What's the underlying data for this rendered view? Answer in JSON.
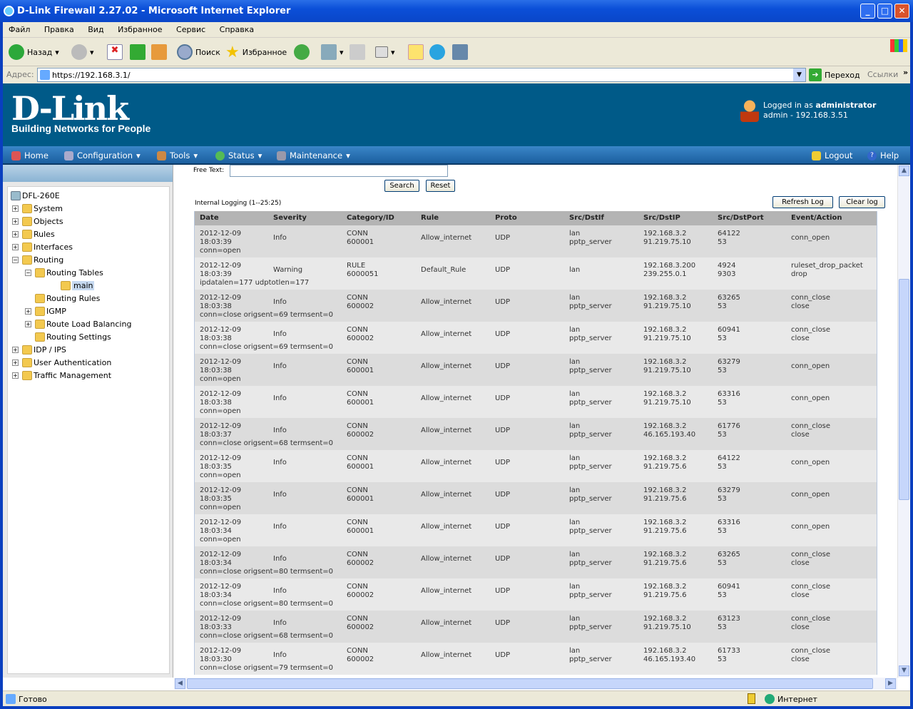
{
  "window": {
    "title": "D-Link Firewall 2.27.02 - Microsoft Internet Explorer"
  },
  "menu": [
    "Файл",
    "Правка",
    "Вид",
    "Избранное",
    "Сервис",
    "Справка"
  ],
  "toolbar": {
    "back": "Назад",
    "search": "Поиск",
    "favorites": "Избранное"
  },
  "address": {
    "label": "Адрес:",
    "url": "https://192.168.3.1/",
    "go": "Переход",
    "links": "Ссылки"
  },
  "banner": {
    "logo": "D-Link",
    "tagline": "Building Networks for People",
    "logged_in_prefix": "Logged in as ",
    "user": "administrator",
    "session": "admin - 192.168.3.51"
  },
  "nav": {
    "home": "Home",
    "configuration": "Configuration",
    "tools": "Tools",
    "status": "Status",
    "maintenance": "Maintenance",
    "logout": "Logout",
    "help": "Help"
  },
  "tree": [
    {
      "label": "DFL-260E",
      "level": 0,
      "pm": ""
    },
    {
      "label": "System",
      "level": 1,
      "pm": "+"
    },
    {
      "label": "Objects",
      "level": 1,
      "pm": "+"
    },
    {
      "label": "Rules",
      "level": 1,
      "pm": "+"
    },
    {
      "label": "Interfaces",
      "level": 1,
      "pm": "+"
    },
    {
      "label": "Routing",
      "level": 1,
      "pm": "-"
    },
    {
      "label": "Routing Tables",
      "level": 2,
      "pm": "-"
    },
    {
      "label": "main",
      "level": 3,
      "pm": "",
      "selected": true
    },
    {
      "label": "Routing Rules",
      "level": 2,
      "pm": ""
    },
    {
      "label": "IGMP",
      "level": 2,
      "pm": "+"
    },
    {
      "label": "Route Load Balancing",
      "level": 2,
      "pm": "+"
    },
    {
      "label": "Routing Settings",
      "level": 2,
      "pm": ""
    },
    {
      "label": "IDP / IPS",
      "level": 1,
      "pm": "+"
    },
    {
      "label": "User Authentication",
      "level": 1,
      "pm": "+"
    },
    {
      "label": "Traffic Management",
      "level": 1,
      "pm": "+"
    }
  ],
  "filter": {
    "free_text_label": "Free Text:",
    "free_text_value": "",
    "search": "Search",
    "reset": "Reset"
  },
  "log": {
    "title": "Internal Logging (1--25:25)",
    "refresh": "Refresh Log",
    "clear": "Clear log",
    "columns": [
      "Date",
      "Severity",
      "Category/ID",
      "Rule",
      "Proto",
      "Src/DstIf",
      "Src/DstIP",
      "Src/DstPort",
      "Event/Action"
    ],
    "rows": [
      {
        "date": "2012-12-09",
        "time": "18:03:39",
        "severity": "Info",
        "cat": "CONN",
        "id": "600001",
        "rule": "Allow_internet",
        "proto": "UDP",
        "srcif": "lan",
        "dstif": "pptp_server",
        "srcip": "192.168.3.2",
        "dstip": "91.219.75.10",
        "srcport": "64122",
        "dstport": "53",
        "event": "conn_open",
        "action": "",
        "msg": "conn=open"
      },
      {
        "date": "2012-12-09",
        "time": "18:03:39",
        "severity": "Warning",
        "cat": "RULE",
        "id": "6000051",
        "rule": "Default_Rule",
        "proto": "UDP",
        "srcif": "lan",
        "dstif": "",
        "srcip": "192.168.3.200",
        "dstip": "239.255.0.1",
        "srcport": "4924",
        "dstport": "9303",
        "event": "ruleset_drop_packet",
        "action": "drop",
        "msg": "ipdatalen=177 udptotlen=177"
      },
      {
        "date": "2012-12-09",
        "time": "18:03:38",
        "severity": "Info",
        "cat": "CONN",
        "id": "600002",
        "rule": "Allow_internet",
        "proto": "UDP",
        "srcif": "lan",
        "dstif": "pptp_server",
        "srcip": "192.168.3.2",
        "dstip": "91.219.75.10",
        "srcport": "63265",
        "dstport": "53",
        "event": "conn_close",
        "action": "close",
        "msg": "conn=close origsent=69 termsent=0"
      },
      {
        "date": "2012-12-09",
        "time": "18:03:38",
        "severity": "Info",
        "cat": "CONN",
        "id": "600002",
        "rule": "Allow_internet",
        "proto": "UDP",
        "srcif": "lan",
        "dstif": "pptp_server",
        "srcip": "192.168.3.2",
        "dstip": "91.219.75.10",
        "srcport": "60941",
        "dstport": "53",
        "event": "conn_close",
        "action": "close",
        "msg": "conn=close origsent=69 termsent=0"
      },
      {
        "date": "2012-12-09",
        "time": "18:03:38",
        "severity": "Info",
        "cat": "CONN",
        "id": "600001",
        "rule": "Allow_internet",
        "proto": "UDP",
        "srcif": "lan",
        "dstif": "pptp_server",
        "srcip": "192.168.3.2",
        "dstip": "91.219.75.10",
        "srcport": "63279",
        "dstport": "53",
        "event": "conn_open",
        "action": "",
        "msg": "conn=open"
      },
      {
        "date": "2012-12-09",
        "time": "18:03:38",
        "severity": "Info",
        "cat": "CONN",
        "id": "600001",
        "rule": "Allow_internet",
        "proto": "UDP",
        "srcif": "lan",
        "dstif": "pptp_server",
        "srcip": "192.168.3.2",
        "dstip": "91.219.75.10",
        "srcport": "63316",
        "dstport": "53",
        "event": "conn_open",
        "action": "",
        "msg": "conn=open"
      },
      {
        "date": "2012-12-09",
        "time": "18:03:37",
        "severity": "Info",
        "cat": "CONN",
        "id": "600002",
        "rule": "Allow_internet",
        "proto": "UDP",
        "srcif": "lan",
        "dstif": "pptp_server",
        "srcip": "192.168.3.2",
        "dstip": "46.165.193.40",
        "srcport": "61776",
        "dstport": "53",
        "event": "conn_close",
        "action": "close",
        "msg": "conn=close origsent=68 termsent=0"
      },
      {
        "date": "2012-12-09",
        "time": "18:03:35",
        "severity": "Info",
        "cat": "CONN",
        "id": "600001",
        "rule": "Allow_internet",
        "proto": "UDP",
        "srcif": "lan",
        "dstif": "pptp_server",
        "srcip": "192.168.3.2",
        "dstip": "91.219.75.6",
        "srcport": "64122",
        "dstport": "53",
        "event": "conn_open",
        "action": "",
        "msg": "conn=open"
      },
      {
        "date": "2012-12-09",
        "time": "18:03:35",
        "severity": "Info",
        "cat": "CONN",
        "id": "600001",
        "rule": "Allow_internet",
        "proto": "UDP",
        "srcif": "lan",
        "dstif": "pptp_server",
        "srcip": "192.168.3.2",
        "dstip": "91.219.75.6",
        "srcport": "63279",
        "dstport": "53",
        "event": "conn_open",
        "action": "",
        "msg": "conn=open"
      },
      {
        "date": "2012-12-09",
        "time": "18:03:34",
        "severity": "Info",
        "cat": "CONN",
        "id": "600001",
        "rule": "Allow_internet",
        "proto": "UDP",
        "srcif": "lan",
        "dstif": "pptp_server",
        "srcip": "192.168.3.2",
        "dstip": "91.219.75.6",
        "srcport": "63316",
        "dstport": "53",
        "event": "conn_open",
        "action": "",
        "msg": "conn=open"
      },
      {
        "date": "2012-12-09",
        "time": "18:03:34",
        "severity": "Info",
        "cat": "CONN",
        "id": "600002",
        "rule": "Allow_internet",
        "proto": "UDP",
        "srcif": "lan",
        "dstif": "pptp_server",
        "srcip": "192.168.3.2",
        "dstip": "91.219.75.6",
        "srcport": "63265",
        "dstport": "53",
        "event": "conn_close",
        "action": "close",
        "msg": "conn=close origsent=80 termsent=0"
      },
      {
        "date": "2012-12-09",
        "time": "18:03:34",
        "severity": "Info",
        "cat": "CONN",
        "id": "600002",
        "rule": "Allow_internet",
        "proto": "UDP",
        "srcif": "lan",
        "dstif": "pptp_server",
        "srcip": "192.168.3.2",
        "dstip": "91.219.75.6",
        "srcport": "60941",
        "dstport": "53",
        "event": "conn_close",
        "action": "close",
        "msg": "conn=close origsent=80 termsent=0"
      },
      {
        "date": "2012-12-09",
        "time": "18:03:33",
        "severity": "Info",
        "cat": "CONN",
        "id": "600002",
        "rule": "Allow_internet",
        "proto": "UDP",
        "srcif": "lan",
        "dstif": "pptp_server",
        "srcip": "192.168.3.2",
        "dstip": "91.219.75.10",
        "srcport": "63123",
        "dstport": "53",
        "event": "conn_close",
        "action": "close",
        "msg": "conn=close origsent=68 termsent=0"
      },
      {
        "date": "2012-12-09",
        "time": "18:03:30",
        "severity": "Info",
        "cat": "CONN",
        "id": "600002",
        "rule": "Allow_internet",
        "proto": "UDP",
        "srcif": "lan",
        "dstif": "pptp_server",
        "srcip": "192.168.3.2",
        "dstip": "46.165.193.40",
        "srcport": "61733",
        "dstport": "53",
        "event": "conn_close",
        "action": "close",
        "msg": "conn=close origsent=79 termsent=0"
      }
    ]
  },
  "statusbar": {
    "status": "Готово",
    "zone": "Интернет"
  }
}
